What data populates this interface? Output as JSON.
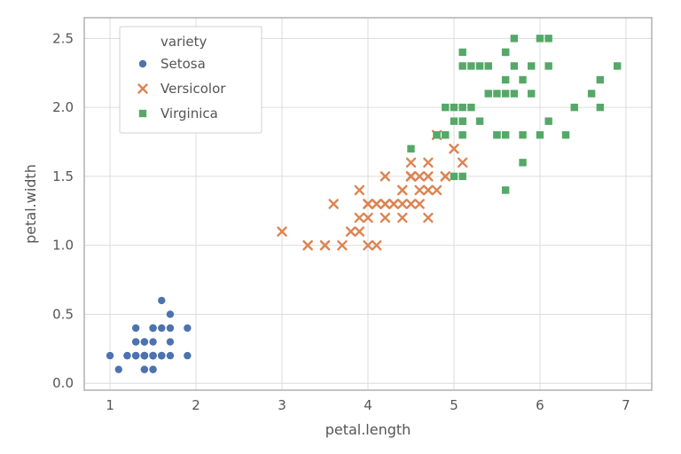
{
  "chart_data": {
    "type": "scatter",
    "xlabel": "petal.length",
    "ylabel": "petal.width",
    "xlim": [
      0.7,
      7.3
    ],
    "ylim": [
      -0.05,
      2.65
    ],
    "xticks": [
      1,
      2,
      3,
      4,
      5,
      6,
      7
    ],
    "yticks": [
      0.0,
      0.5,
      1.0,
      1.5,
      2.0,
      2.5
    ],
    "legend": {
      "title": "variety",
      "position": "upper-left-inside"
    },
    "colors": {
      "Setosa": "#4c72b0",
      "Versicolor": "#dd8452",
      "Virginica": "#55a868"
    },
    "markers": {
      "Setosa": "circle",
      "Versicolor": "x",
      "Virginica": "square"
    },
    "series": [
      {
        "name": "Setosa",
        "points": [
          [
            1.4,
            0.2
          ],
          [
            1.4,
            0.2
          ],
          [
            1.3,
            0.2
          ],
          [
            1.5,
            0.2
          ],
          [
            1.4,
            0.2
          ],
          [
            1.7,
            0.4
          ],
          [
            1.4,
            0.3
          ],
          [
            1.5,
            0.2
          ],
          [
            1.4,
            0.2
          ],
          [
            1.5,
            0.1
          ],
          [
            1.5,
            0.2
          ],
          [
            1.6,
            0.2
          ],
          [
            1.4,
            0.1
          ],
          [
            1.1,
            0.1
          ],
          [
            1.2,
            0.2
          ],
          [
            1.5,
            0.4
          ],
          [
            1.3,
            0.4
          ],
          [
            1.4,
            0.3
          ],
          [
            1.7,
            0.3
          ],
          [
            1.5,
            0.3
          ],
          [
            1.7,
            0.2
          ],
          [
            1.5,
            0.4
          ],
          [
            1.0,
            0.2
          ],
          [
            1.7,
            0.5
          ],
          [
            1.9,
            0.2
          ],
          [
            1.6,
            0.2
          ],
          [
            1.6,
            0.4
          ],
          [
            1.5,
            0.2
          ],
          [
            1.4,
            0.2
          ],
          [
            1.6,
            0.2
          ],
          [
            1.6,
            0.2
          ],
          [
            1.5,
            0.4
          ],
          [
            1.5,
            0.1
          ],
          [
            1.4,
            0.2
          ],
          [
            1.5,
            0.2
          ],
          [
            1.2,
            0.2
          ],
          [
            1.3,
            0.2
          ],
          [
            1.4,
            0.1
          ],
          [
            1.3,
            0.2
          ],
          [
            1.5,
            0.2
          ],
          [
            1.3,
            0.3
          ],
          [
            1.3,
            0.3
          ],
          [
            1.3,
            0.2
          ],
          [
            1.6,
            0.6
          ],
          [
            1.9,
            0.4
          ],
          [
            1.4,
            0.3
          ],
          [
            1.6,
            0.2
          ],
          [
            1.4,
            0.2
          ],
          [
            1.5,
            0.2
          ],
          [
            1.4,
            0.2
          ]
        ]
      },
      {
        "name": "Versicolor",
        "points": [
          [
            4.7,
            1.4
          ],
          [
            4.5,
            1.5
          ],
          [
            4.9,
            1.5
          ],
          [
            4.0,
            1.3
          ],
          [
            4.6,
            1.5
          ],
          [
            4.5,
            1.3
          ],
          [
            4.7,
            1.6
          ],
          [
            3.3,
            1.0
          ],
          [
            4.6,
            1.3
          ],
          [
            3.9,
            1.4
          ],
          [
            3.5,
            1.0
          ],
          [
            4.2,
            1.5
          ],
          [
            4.0,
            1.0
          ],
          [
            4.7,
            1.4
          ],
          [
            3.6,
            1.3
          ],
          [
            4.4,
            1.4
          ],
          [
            4.5,
            1.5
          ],
          [
            4.1,
            1.0
          ],
          [
            4.5,
            1.5
          ],
          [
            3.9,
            1.1
          ],
          [
            4.8,
            1.8
          ],
          [
            4.0,
            1.3
          ],
          [
            4.9,
            1.5
          ],
          [
            4.7,
            1.2
          ],
          [
            4.3,
            1.3
          ],
          [
            4.4,
            1.4
          ],
          [
            4.8,
            1.4
          ],
          [
            5.0,
            1.7
          ],
          [
            4.5,
            1.5
          ],
          [
            3.5,
            1.0
          ],
          [
            3.8,
            1.1
          ],
          [
            3.7,
            1.0
          ],
          [
            3.9,
            1.2
          ],
          [
            5.1,
            1.6
          ],
          [
            4.5,
            1.5
          ],
          [
            4.5,
            1.6
          ],
          [
            4.7,
            1.5
          ],
          [
            4.4,
            1.3
          ],
          [
            4.1,
            1.3
          ],
          [
            4.0,
            1.3
          ],
          [
            4.4,
            1.2
          ],
          [
            4.6,
            1.4
          ],
          [
            4.0,
            1.2
          ],
          [
            3.3,
            1.0
          ],
          [
            4.2,
            1.3
          ],
          [
            4.2,
            1.2
          ],
          [
            4.2,
            1.3
          ],
          [
            4.3,
            1.3
          ],
          [
            3.0,
            1.1
          ],
          [
            4.1,
            1.3
          ]
        ]
      },
      {
        "name": "Virginica",
        "points": [
          [
            6.0,
            2.5
          ],
          [
            5.1,
            1.9
          ],
          [
            5.9,
            2.1
          ],
          [
            5.6,
            1.8
          ],
          [
            5.8,
            2.2
          ],
          [
            6.6,
            2.1
          ],
          [
            4.5,
            1.7
          ],
          [
            6.3,
            1.8
          ],
          [
            5.8,
            1.8
          ],
          [
            6.1,
            2.5
          ],
          [
            5.1,
            2.0
          ],
          [
            5.3,
            1.9
          ],
          [
            5.5,
            2.1
          ],
          [
            5.0,
            2.0
          ],
          [
            5.1,
            2.4
          ],
          [
            5.3,
            2.3
          ],
          [
            5.5,
            1.8
          ],
          [
            6.7,
            2.2
          ],
          [
            6.9,
            2.3
          ],
          [
            5.0,
            1.5
          ],
          [
            5.7,
            2.3
          ],
          [
            4.9,
            2.0
          ],
          [
            6.7,
            2.0
          ],
          [
            4.9,
            1.8
          ],
          [
            5.7,
            2.1
          ],
          [
            6.0,
            1.8
          ],
          [
            4.8,
            1.8
          ],
          [
            4.9,
            1.8
          ],
          [
            5.6,
            2.1
          ],
          [
            5.8,
            1.6
          ],
          [
            6.1,
            1.9
          ],
          [
            6.4,
            2.0
          ],
          [
            5.6,
            2.2
          ],
          [
            5.1,
            1.5
          ],
          [
            5.6,
            1.4
          ],
          [
            6.1,
            2.3
          ],
          [
            5.6,
            2.4
          ],
          [
            5.5,
            1.8
          ],
          [
            4.8,
            1.8
          ],
          [
            5.4,
            2.1
          ],
          [
            5.6,
            2.4
          ],
          [
            5.1,
            2.3
          ],
          [
            5.1,
            1.9
          ],
          [
            5.9,
            2.3
          ],
          [
            5.7,
            2.5
          ],
          [
            5.2,
            2.3
          ],
          [
            5.0,
            1.9
          ],
          [
            5.2,
            2.0
          ],
          [
            5.4,
            2.3
          ],
          [
            5.1,
            1.8
          ]
        ]
      }
    ]
  }
}
